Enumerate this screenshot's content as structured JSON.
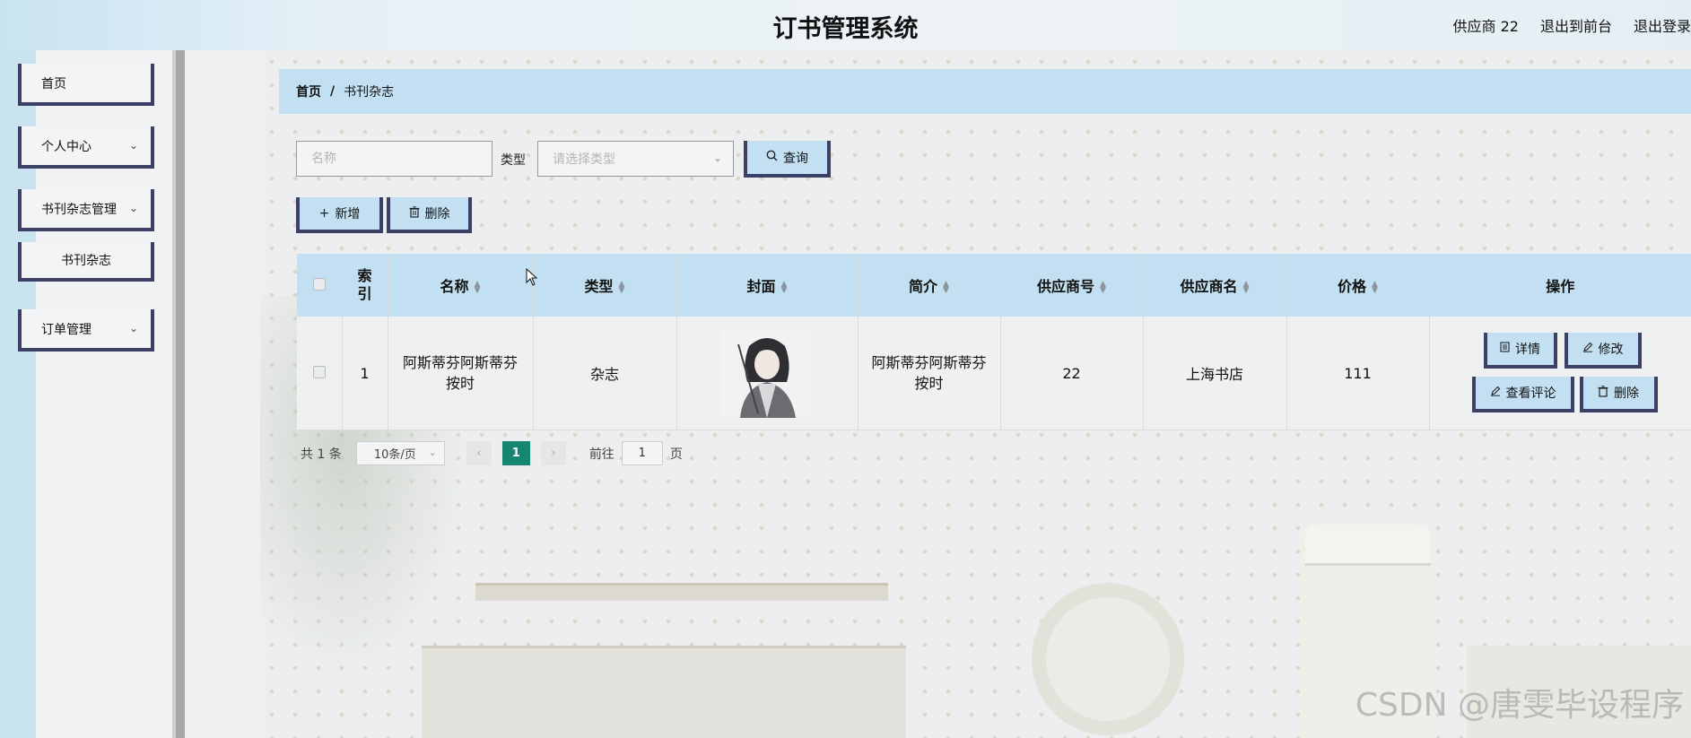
{
  "header": {
    "title": "订书管理系统",
    "user": "供应商 22",
    "exit_front": "退出到前台",
    "logout": "退出登录"
  },
  "sidebar": {
    "items": [
      {
        "label": "首页",
        "chevron": false
      },
      {
        "label": "个人中心",
        "chevron": true
      },
      {
        "label": "书刊杂志管理",
        "chevron": true
      },
      {
        "label": "书刊杂志",
        "chevron": false,
        "submenu": true
      },
      {
        "label": "订单管理",
        "chevron": true
      }
    ]
  },
  "breadcrumb": {
    "home": "首页",
    "separator": "/",
    "current": "书刊杂志"
  },
  "search": {
    "name_placeholder": "名称",
    "type_label": "类型",
    "type_placeholder": "请选择类型",
    "search_label": "查询"
  },
  "toolbar": {
    "add_label": "新增",
    "delete_label": "删除"
  },
  "table": {
    "columns": [
      "索引",
      "名称",
      "类型",
      "封面",
      "简介",
      "供应商号",
      "供应商名",
      "价格",
      "操作"
    ],
    "rows": [
      {
        "index": "1",
        "name": "阿斯蒂芬阿斯蒂芬按时",
        "type": "杂志",
        "cover": "portrait-illustration",
        "intro": "阿斯蒂芬阿斯蒂芬按时",
        "supplier_no": "22",
        "supplier_name": "上海书店",
        "price": "111",
        "actions": {
          "detail": "详情",
          "edit": "修改",
          "comments": "查看评论",
          "delete": "删除"
        }
      }
    ]
  },
  "pagination": {
    "total": "共 1 条",
    "page_size": "10条/页",
    "current_page": "1",
    "goto_label": "前往",
    "goto_value": "1",
    "page_suffix": "页"
  },
  "watermark": "CSDN @唐雯毕设程序",
  "colors": {
    "accent": "#c2e0f1",
    "border_dark": "#3d4066",
    "active_page": "#14876e"
  }
}
